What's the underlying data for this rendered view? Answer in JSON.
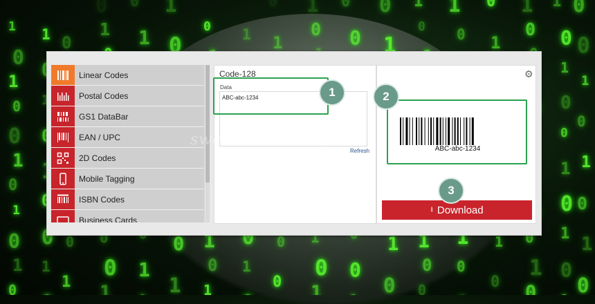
{
  "sidebar": {
    "items": [
      {
        "label": "Linear Codes",
        "icon": "linear-barcode-icon"
      },
      {
        "label": "Postal Codes",
        "icon": "postal-barcode-icon"
      },
      {
        "label": "GS1 DataBar",
        "icon": "gs1-databar-icon"
      },
      {
        "label": "EAN / UPC",
        "icon": "ean-upc-icon"
      },
      {
        "label": "2D Codes",
        "icon": "qr-code-icon"
      },
      {
        "label": "Mobile Tagging",
        "icon": "mobile-phone-icon"
      },
      {
        "label": "ISBN Codes",
        "icon": "isbn-icon"
      },
      {
        "label": "Business Cards",
        "icon": "business-card-icon"
      }
    ]
  },
  "editor": {
    "symbology": "Code-128",
    "data_label": "Data",
    "data_value": "ABC-abc-1234",
    "refresh_label": "Refresh"
  },
  "preview": {
    "barcode_text": "ABC-abc-1234",
    "download_label": "Download"
  },
  "callouts": [
    "1",
    "2",
    "3"
  ],
  "watermark": "sweetmul.tistory.com",
  "colors": {
    "accent_red": "#c9242c",
    "active_orange": "#f07a2a",
    "callout_green": "#2aa150",
    "badge_teal": "#6a9a8a"
  }
}
